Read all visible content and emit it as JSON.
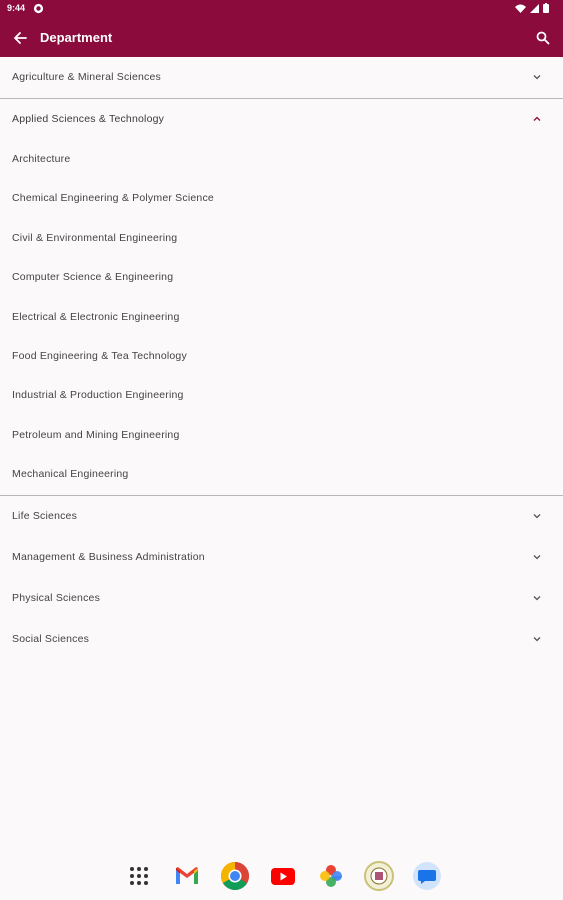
{
  "status": {
    "time": "9:44"
  },
  "appbar": {
    "title": "Department"
  },
  "icons": {
    "back": "arrow-back-icon",
    "search": "search-icon",
    "expand": "chevron-down-icon",
    "collapse": "chevron-up-icon"
  },
  "colors": {
    "primary": "#8a0b3c",
    "background": "#fbf9fa",
    "divider": "#b9b6b8"
  },
  "sections": [
    {
      "label": "Agriculture & Mineral Sciences",
      "expanded": false
    },
    {
      "label": "Applied Sciences & Technology",
      "expanded": true,
      "items": [
        "Architecture",
        "Chemical Engineering & Polymer Science",
        "Civil & Environmental Engineering",
        "Computer Science & Engineering",
        "Electrical & Electronic Engineering",
        "Food Engineering & Tea Technology",
        "Industrial & Production Engineering",
        "Petroleum and Mining Engineering",
        "Mechanical Engineering"
      ]
    },
    {
      "label": "Life Sciences",
      "expanded": false
    },
    {
      "label": "Management & Business Administration",
      "expanded": false
    },
    {
      "label": "Physical Sciences",
      "expanded": false
    },
    {
      "label": "Social Sciences",
      "expanded": false
    }
  ],
  "dock": [
    "apps-grid-icon",
    "gmail-icon",
    "chrome-icon",
    "youtube-icon",
    "photos-icon",
    "university-app-icon",
    "messages-icon"
  ]
}
